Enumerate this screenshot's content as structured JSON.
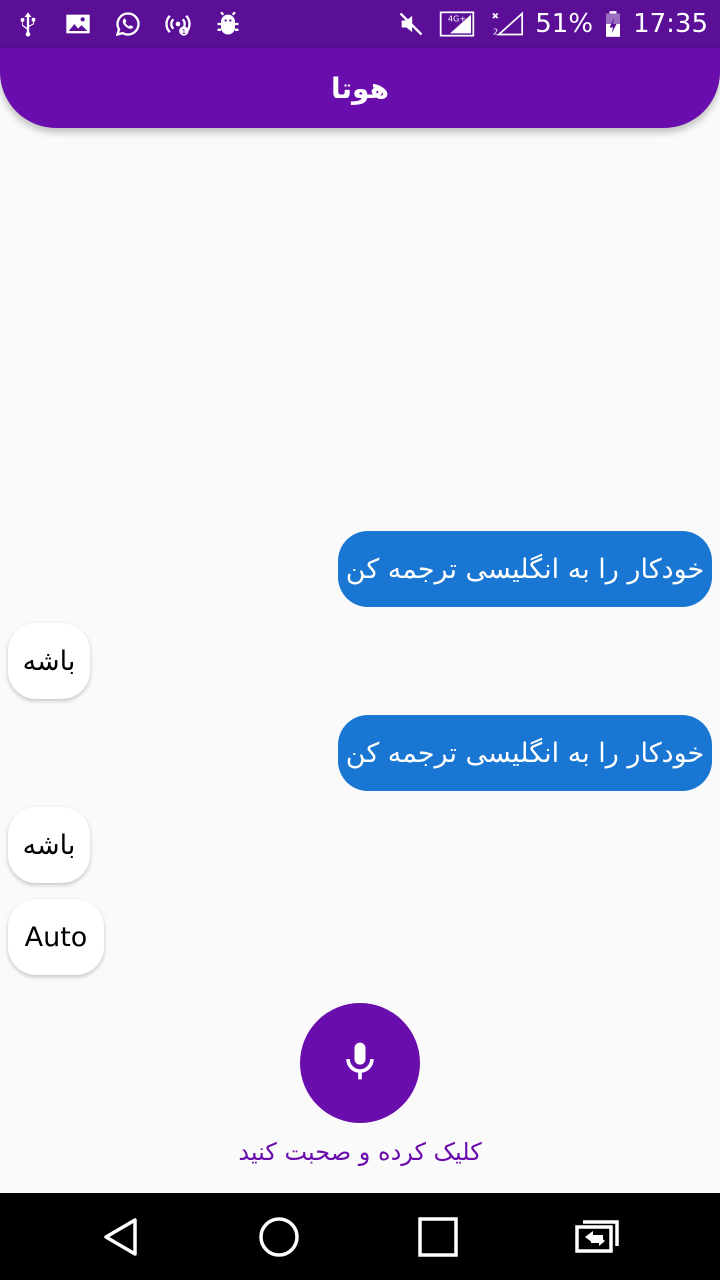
{
  "status_bar": {
    "battery_percent": "51%",
    "time": "17:35",
    "network_label": "4G+",
    "left_icons": [
      "usb-icon",
      "image-icon",
      "whatsapp-icon",
      "hotspot-icon",
      "android-debug-icon"
    ],
    "right_icons": [
      "mute-icon",
      "signal-4g-icon",
      "signal-sim2-icon",
      "battery-charging-icon"
    ]
  },
  "app_bar": {
    "title": "هوتا"
  },
  "messages": [
    {
      "role": "user",
      "text": "خودکار را به انگلیسی ترجمه کن"
    },
    {
      "role": "bot",
      "text": "باشه"
    },
    {
      "role": "user",
      "text": "خودکار را به انگلیسی ترجمه کن"
    },
    {
      "role": "bot",
      "text": "باشه"
    },
    {
      "role": "bot",
      "text": "Auto"
    }
  ],
  "mic": {
    "icon": "microphone-icon",
    "hint": "کلیک کرده و صحبت کنید"
  },
  "nav_bar": {
    "icons": [
      "back-icon",
      "home-icon",
      "recents-icon",
      "switch-icon"
    ]
  },
  "colors": {
    "status_bar": "#5a0f96",
    "app_bar": "#6a0dad",
    "user_bubble": "#1976d2",
    "bot_bubble": "#ffffff",
    "background": "#fafafa"
  }
}
